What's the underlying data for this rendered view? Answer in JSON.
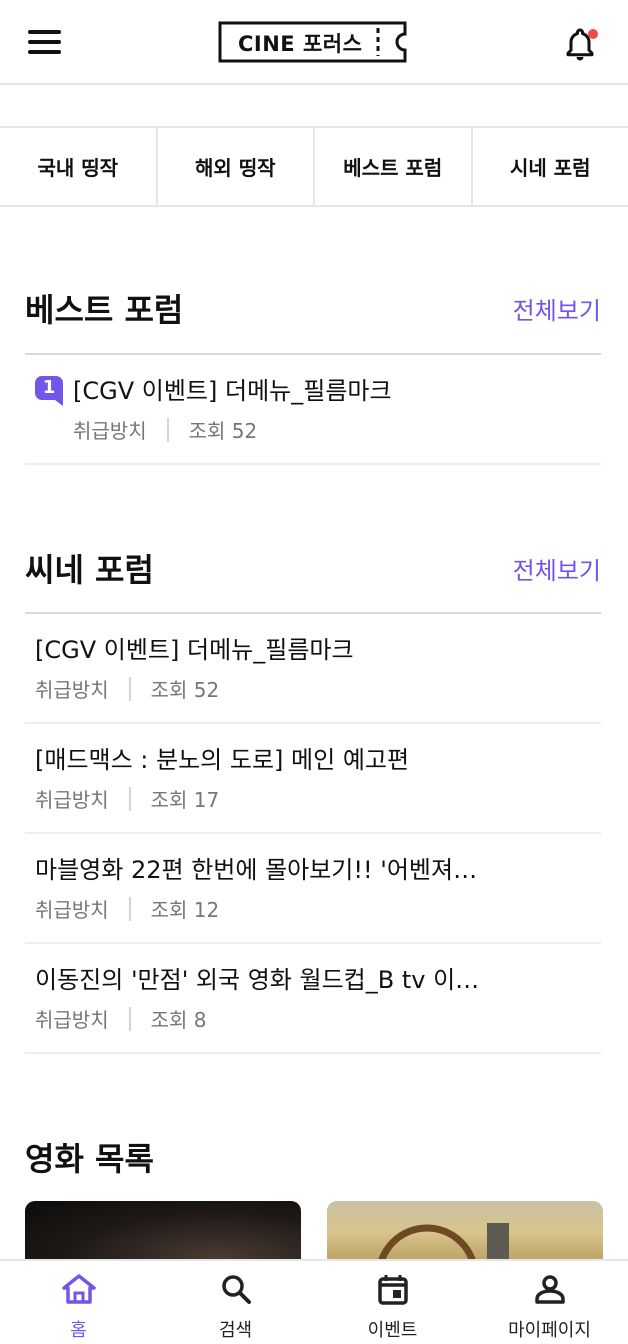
{
  "header": {
    "logo_text": "CINE 포러스",
    "menu_icon": "hamburger-menu-icon",
    "notification_icon": "bell-icon",
    "notification_dot_color": "#f04a4a"
  },
  "tabs": [
    "국내 띵작",
    "해외 띵작",
    "베스트 포럼",
    "시네 포럼"
  ],
  "accent_color": "#7156e8",
  "best_forum": {
    "title": "베스트 포럼",
    "more": "전체보기",
    "posts": [
      {
        "rank": "1",
        "title": "[CGV 이벤트] 더메뉴_필름마크",
        "category": "취급방치",
        "views": "조회 52"
      }
    ]
  },
  "cine_forum": {
    "title": "씨네 포럼",
    "more": "전체보기",
    "posts": [
      {
        "title": "[CGV 이벤트] 더메뉴_필름마크",
        "category": "취급방치",
        "views": "조회 52"
      },
      {
        "title": "[매드맥스 : 분노의 도로] 메인 예고편",
        "category": "취급방치",
        "views": "조회 17"
      },
      {
        "title": "마블영화 22편 한번에 몰아보기!! '어벤져'…",
        "category": "취급방치",
        "views": "조회 12"
      },
      {
        "title": "이동진의 '만점' 외국 영화 월드컵_B tv 이…",
        "category": "취급방치",
        "views": "조회 8"
      }
    ]
  },
  "movies": {
    "title": "영화 목록"
  },
  "bottom_nav": [
    {
      "label": "홈",
      "icon": "home-icon",
      "active": true
    },
    {
      "label": "검색",
      "icon": "search-icon",
      "active": false
    },
    {
      "label": "이벤트",
      "icon": "calendar-icon",
      "active": false
    },
    {
      "label": "마이페이지",
      "icon": "person-icon",
      "active": false
    }
  ]
}
